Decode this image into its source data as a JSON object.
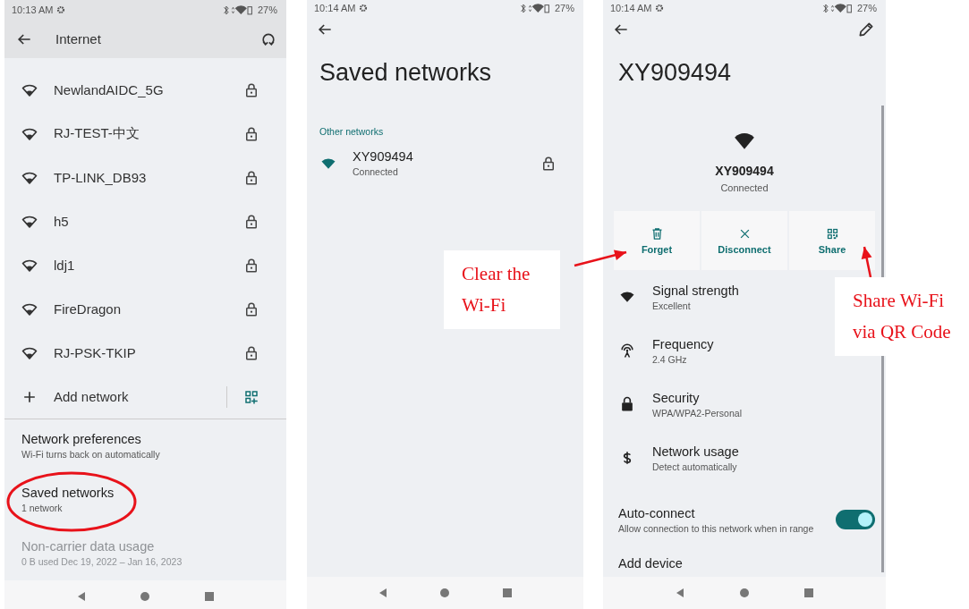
{
  "internet_screen": {
    "status_bar": {
      "time": "10:13 AM",
      "battery": "27%"
    },
    "title": "Internet",
    "networks": [
      {
        "name": "NewlandAIDC_5G"
      },
      {
        "name": "RJ-TEST-中文"
      },
      {
        "name": "TP-LINK_DB93"
      },
      {
        "name": "h5"
      },
      {
        "name": "ldj1"
      },
      {
        "name": "FireDragon"
      },
      {
        "name": "RJ-PSK-TKIP"
      }
    ],
    "add_network": "Add network",
    "preferences": [
      {
        "title": "Network preferences",
        "subtitle": "Wi-Fi turns back on automatically",
        "disabled": false,
        "circled": false
      },
      {
        "title": "Saved networks",
        "subtitle": "1 network",
        "disabled": false,
        "circled": true
      },
      {
        "title": "Non-carrier data usage",
        "subtitle": "0 B used Dec 19, 2022 – Jan 16, 2023",
        "disabled": true,
        "circled": false
      }
    ]
  },
  "saved_networks_screen": {
    "status_bar": {
      "time": "10:14 AM",
      "battery": "27%"
    },
    "title": "Saved networks",
    "section": "Other networks",
    "networks": [
      {
        "name": "XY909494",
        "status": "Connected"
      }
    ]
  },
  "network_details_screen": {
    "status_bar": {
      "time": "10:14 AM",
      "battery": "27%"
    },
    "title": "XY909494",
    "name": "XY909494",
    "status": "Connected",
    "actions": [
      {
        "kind": "trash",
        "label": "Forget"
      },
      {
        "kind": "close",
        "label": "Disconnect"
      },
      {
        "kind": "qr",
        "label": "Share"
      }
    ],
    "details": [
      {
        "kind": "wifi",
        "title": "Signal strength",
        "subtitle": "Excellent"
      },
      {
        "kind": "antenna",
        "title": "Frequency",
        "subtitle": "2.4 GHz"
      },
      {
        "kind": "lock",
        "title": "Security",
        "subtitle": "WPA/WPA2-Personal"
      },
      {
        "kind": "dollar",
        "title": "Network usage",
        "subtitle": "Detect automatically"
      }
    ],
    "auto_connect": {
      "title": "Auto-connect",
      "subtitle": "Allow connection to this network when in range",
      "on": true
    },
    "add_device": {
      "title": "Add device"
    }
  },
  "callouts": [
    {
      "lines": [
        "Clear the",
        "Wi-Fi"
      ]
    },
    {
      "lines": [
        "Share Wi-Fi",
        "via QR Code"
      ]
    }
  ]
}
